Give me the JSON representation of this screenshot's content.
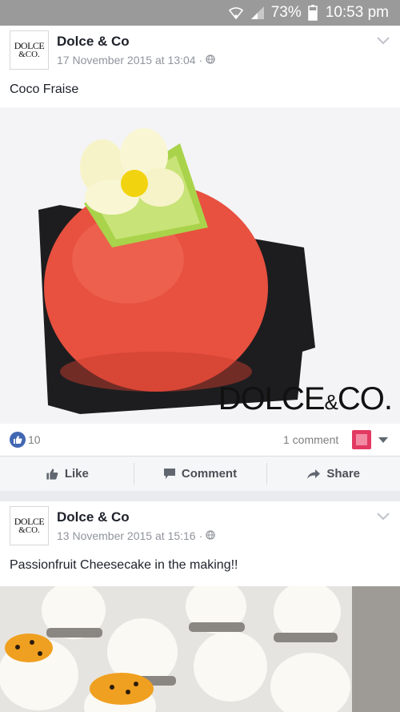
{
  "status_bar": {
    "battery": "73%",
    "time": "10:53 pm"
  },
  "posts": [
    {
      "author": "Dolce & Co",
      "avatar": {
        "line1": "DOLCE",
        "line2": "&CO."
      },
      "date": "17 November 2015 at 13:04",
      "meta_separator": "·",
      "text": "Coco Fraise",
      "photo_watermark": {
        "main": "DOLCE",
        "amp": "&",
        "suffix": "CO."
      },
      "likes": "10",
      "comments": "1 comment"
    },
    {
      "author": "Dolce & Co",
      "avatar": {
        "line1": "DOLCE",
        "line2": "&CO."
      },
      "date": "13 November 2015 at 15:16",
      "meta_separator": "·",
      "text": "Passionfruit Cheesecake in the making!!"
    }
  ],
  "actions": {
    "like": "Like",
    "comment": "Comment",
    "share": "Share"
  },
  "colors": {
    "status_bar": "#9a9a9a",
    "like_blue": "#4267b2",
    "cake_red": "#e8503f",
    "page_bg": "#e9ebee"
  }
}
